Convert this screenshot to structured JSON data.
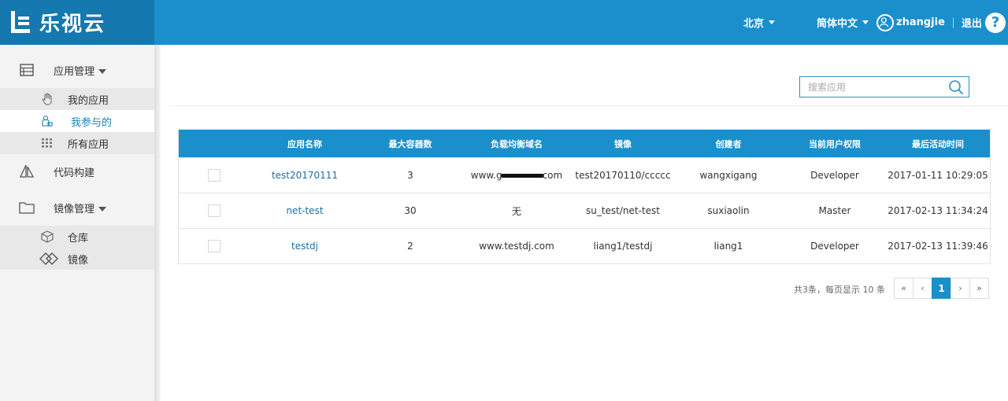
{
  "header": {
    "logo_text": "乐视云",
    "region": "北京",
    "language": "简体中文",
    "username": "zhangjie",
    "logout": "退出",
    "help": "?"
  },
  "sidebar": {
    "groups": [
      {
        "label": "应用管理",
        "icon": "server-icon"
      },
      {
        "label": "代码构建",
        "icon": "sail-icon"
      },
      {
        "label": "镜像管理",
        "icon": "folder-icon"
      }
    ],
    "app_items": [
      {
        "label": "我的应用",
        "icon": "hand-icon"
      },
      {
        "label": "我参与的",
        "icon": "participate-icon",
        "active": true
      },
      {
        "label": "所有应用",
        "icon": "grid-icon"
      }
    ],
    "image_items": [
      {
        "label": "仓库",
        "icon": "cube-icon"
      },
      {
        "label": "镜像",
        "icon": "diamond-link-icon"
      }
    ]
  },
  "search": {
    "placeholder": "搜索应用"
  },
  "table": {
    "headers": [
      "",
      "应用名称",
      "最大容器数",
      "负载均衡域名",
      "镜像",
      "创建者",
      "当前用户权限",
      "最后活动时间"
    ],
    "rows": [
      {
        "name": "test20170111",
        "max": "3",
        "domain_pre": "www.g",
        "domain_post": "com",
        "image": "test20170110/ccccc",
        "creator": "wangxigang",
        "perm": "Developer",
        "time": "2017-01-11 10:29:05"
      },
      {
        "name": "net-test",
        "max": "30",
        "domain": "无",
        "image": "su_test/net-test",
        "creator": "suxiaolin",
        "perm": "Master",
        "time": "2017-02-13 11:34:24"
      },
      {
        "name": "testdj",
        "max": "2",
        "domain": "www.testdj.com",
        "image": "liang1/testdj",
        "creator": "liang1",
        "perm": "Developer",
        "time": "2017-02-13 11:39:46"
      }
    ]
  },
  "pagination": {
    "info": "共3条，每页显示 10 条",
    "first": "«",
    "prev": "‹",
    "current": "1",
    "next": "›",
    "last": "»"
  },
  "colors": {
    "primary": "#1a8fcc",
    "logo_bg": "#1578ae",
    "link": "#1a6fa6"
  }
}
